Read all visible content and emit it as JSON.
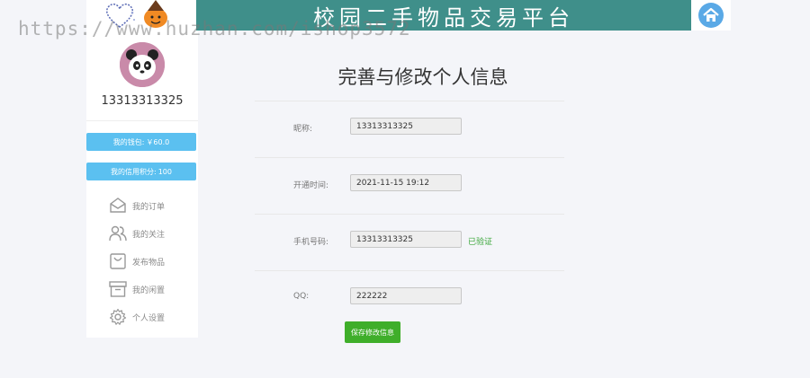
{
  "header": {
    "site_title": "校园二手物品交易平台",
    "watermark": "https://www.huzhan.com/ishop3572"
  },
  "sidebar": {
    "username": "13313313325",
    "wallet_label": "我的钱包:",
    "wallet_value": "￥60.0",
    "credit_label": "我的信用积分:",
    "credit_value": "100",
    "menu": [
      {
        "label": "我的订单",
        "icon": "envelope-icon"
      },
      {
        "label": "我的关注",
        "icon": "users-icon"
      },
      {
        "label": "发布物品",
        "icon": "bag-icon"
      },
      {
        "label": "我的闲置",
        "icon": "archive-box-icon"
      },
      {
        "label": "个人设置",
        "icon": "gear-icon"
      }
    ]
  },
  "main": {
    "title": "完善与修改个人信息",
    "fields": {
      "nickname_label": "昵称:",
      "nickname_value": "13313313325",
      "open_time_label": "开通时间:",
      "open_time_value": "2021-11-15 19:12",
      "phone_label": "手机号码:",
      "phone_value": "13313313325",
      "phone_status": "已验证",
      "qq_label": "QQ:",
      "qq_value": "222222"
    },
    "save_label": "保存修改信息"
  },
  "colors": {
    "banner": "#3f8f8a",
    "pill": "#5bc0f0",
    "save_button": "#3fae2a",
    "verified": "#3aa63a"
  }
}
